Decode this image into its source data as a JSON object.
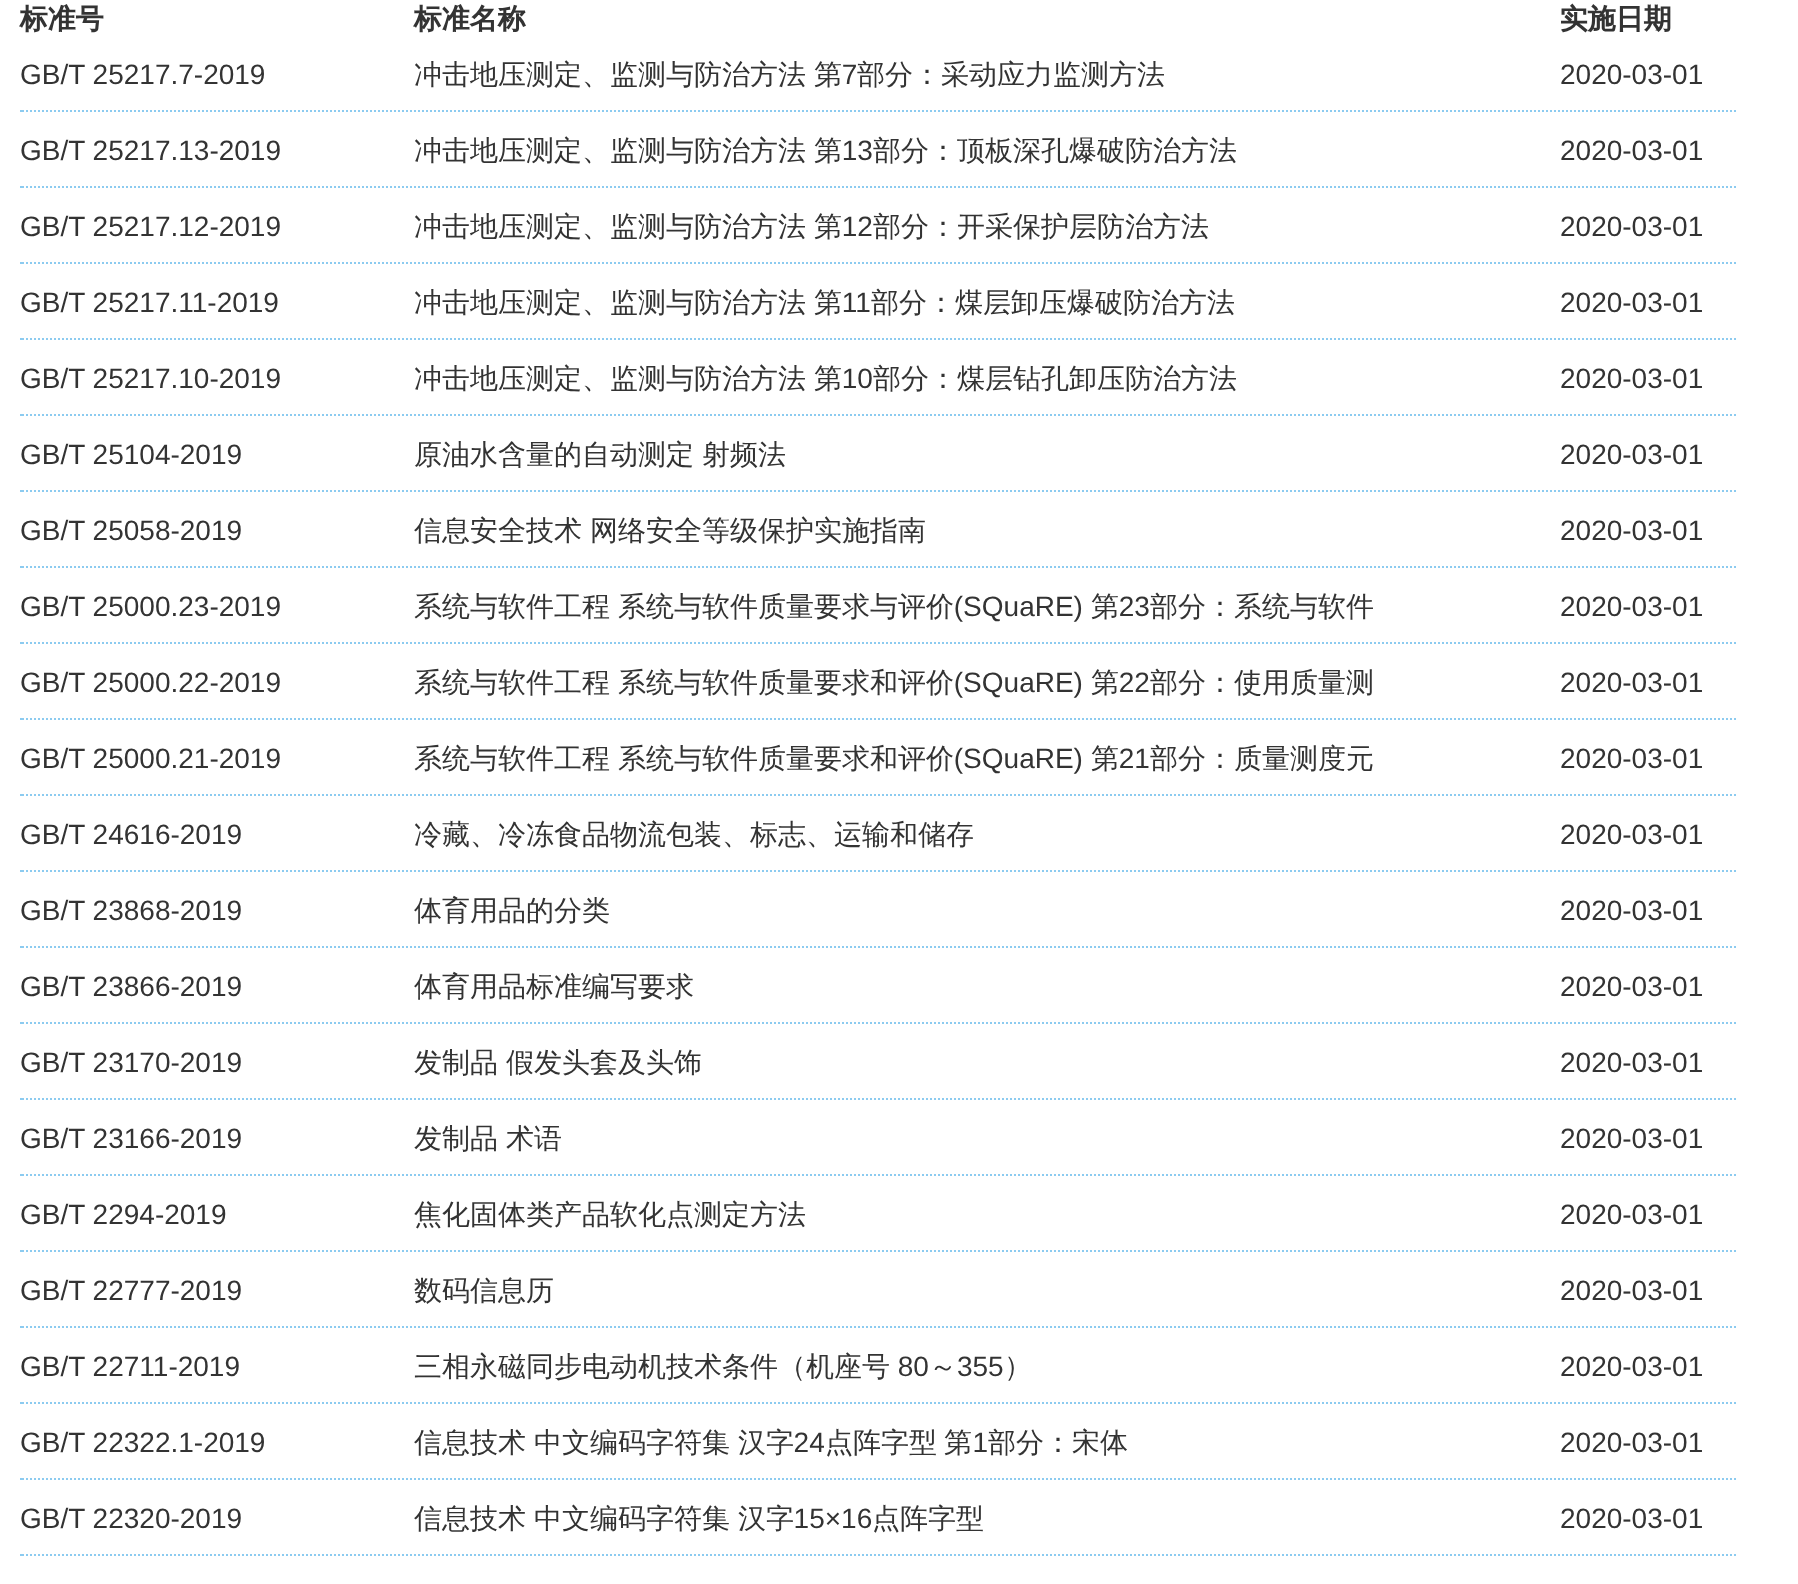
{
  "table": {
    "columns": [
      "标准号",
      "标准名称",
      "实施日期"
    ],
    "rows": [
      {
        "number": "GB/T 25217.7-2019",
        "name": "冲击地压测定、监测与防治方法 第7部分：采动应力监测方法",
        "date": "2020-03-01"
      },
      {
        "number": "GB/T 25217.13-2019",
        "name": "冲击地压测定、监测与防治方法 第13部分：顶板深孔爆破防治方法",
        "date": "2020-03-01"
      },
      {
        "number": "GB/T 25217.12-2019",
        "name": "冲击地压测定、监测与防治方法 第12部分：开采保护层防治方法",
        "date": "2020-03-01"
      },
      {
        "number": "GB/T 25217.11-2019",
        "name": "冲击地压测定、监测与防治方法 第11部分：煤层卸压爆破防治方法",
        "date": "2020-03-01"
      },
      {
        "number": "GB/T 25217.10-2019",
        "name": "冲击地压测定、监测与防治方法 第10部分：煤层钻孔卸压防治方法",
        "date": "2020-03-01"
      },
      {
        "number": "GB/T 25104-2019",
        "name": "原油水含量的自动测定 射频法",
        "date": "2020-03-01"
      },
      {
        "number": "GB/T 25058-2019",
        "name": "信息安全技术 网络安全等级保护实施指南",
        "date": "2020-03-01"
      },
      {
        "number": "GB/T 25000.23-2019",
        "name": "系统与软件工程 系统与软件质量要求与评价(SQuaRE) 第23部分：系统与软件",
        "date": "2020-03-01"
      },
      {
        "number": "GB/T 25000.22-2019",
        "name": "系统与软件工程 系统与软件质量要求和评价(SQuaRE) 第22部分：使用质量测",
        "date": "2020-03-01"
      },
      {
        "number": "GB/T 25000.21-2019",
        "name": "系统与软件工程 系统与软件质量要求和评价(SQuaRE) 第21部分：质量测度元",
        "date": "2020-03-01"
      },
      {
        "number": "GB/T 24616-2019",
        "name": "冷藏、冷冻食品物流包装、标志、运输和储存",
        "date": "2020-03-01"
      },
      {
        "number": "GB/T 23868-2019",
        "name": "体育用品的分类",
        "date": "2020-03-01"
      },
      {
        "number": "GB/T 23866-2019",
        "name": "体育用品标准编写要求",
        "date": "2020-03-01"
      },
      {
        "number": "GB/T 23170-2019",
        "name": "发制品 假发头套及头饰",
        "date": "2020-03-01"
      },
      {
        "number": "GB/T 23166-2019",
        "name": "发制品 术语",
        "date": "2020-03-01"
      },
      {
        "number": "GB/T 2294-2019",
        "name": "焦化固体类产品软化点测定方法",
        "date": "2020-03-01"
      },
      {
        "number": "GB/T 22777-2019",
        "name": "数码信息历",
        "date": "2020-03-01"
      },
      {
        "number": "GB/T 22711-2019",
        "name": "三相永磁同步电动机技术条件（机座号 80～355）",
        "date": "2020-03-01"
      },
      {
        "number": "GB/T 22322.1-2019",
        "name": "信息技术 中文编码字符集 汉字24点阵字型 第1部分：宋体",
        "date": "2020-03-01"
      },
      {
        "number": "GB/T 22320-2019",
        "name": "信息技术 中文编码字符集 汉字15×16点阵字型",
        "date": "2020-03-01"
      }
    ]
  }
}
